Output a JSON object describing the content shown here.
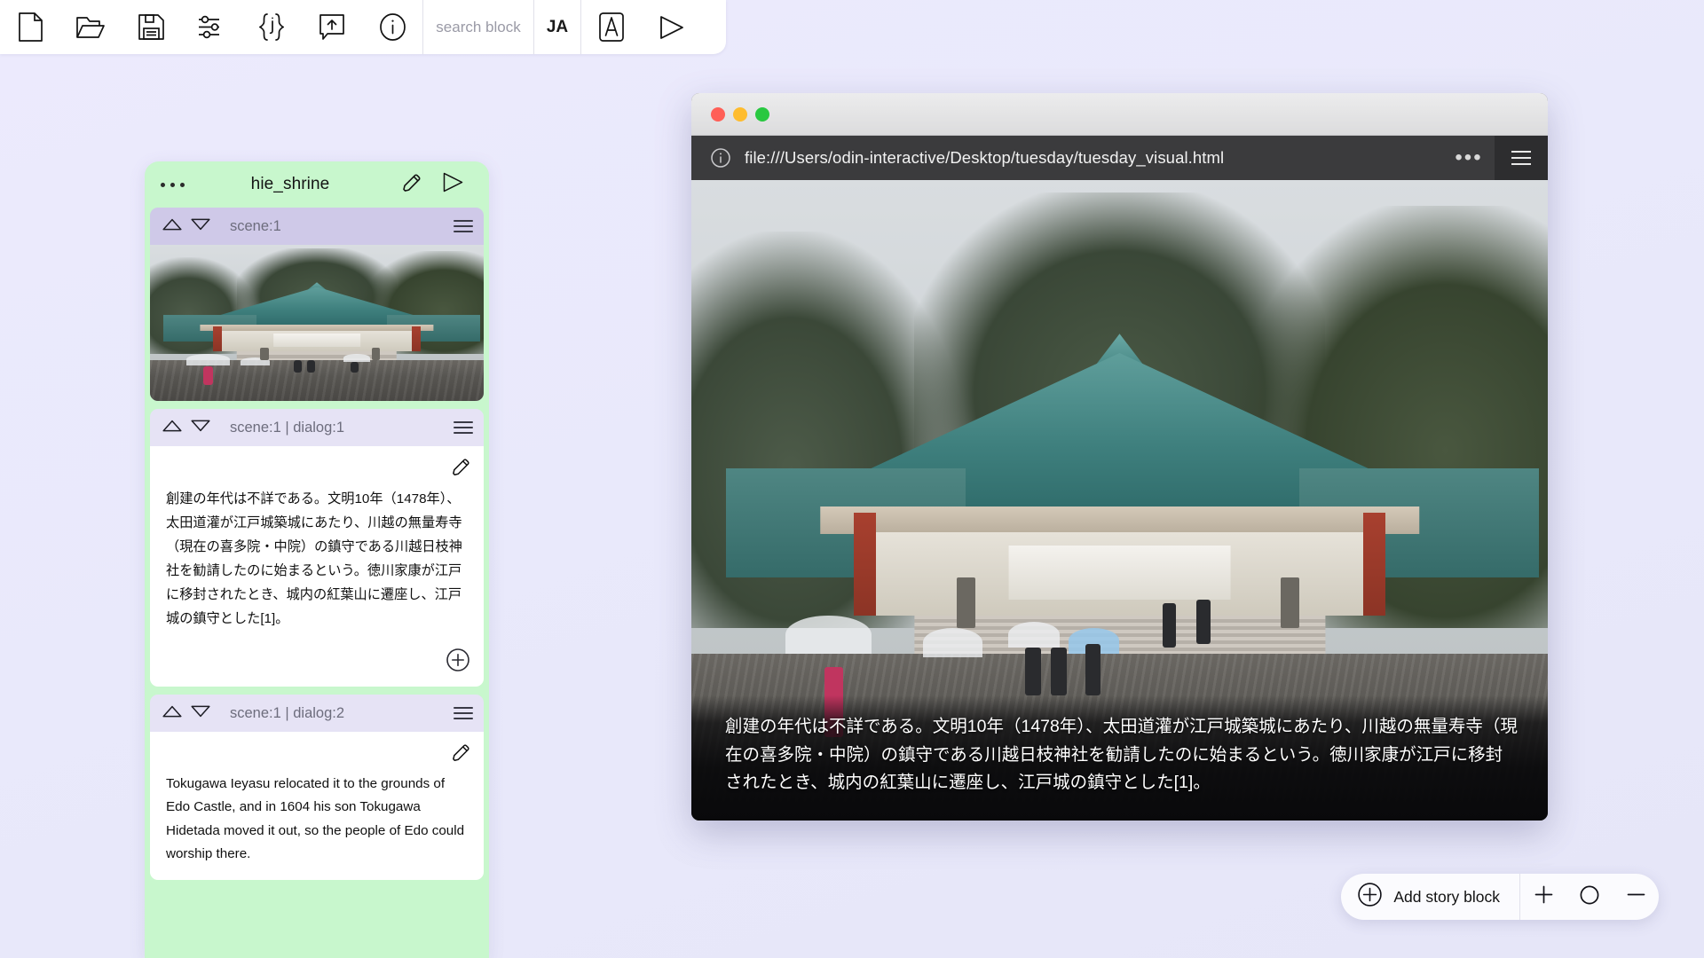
{
  "toolbar": {
    "buttons": [
      {
        "name": "new-file-icon",
        "label": "New"
      },
      {
        "name": "open-folder-icon",
        "label": "Open"
      },
      {
        "name": "save-disk-icon",
        "label": "Save"
      },
      {
        "name": "settings-sliders-icon",
        "label": "Settings"
      },
      {
        "name": "json-braces-icon",
        "label": "{j}"
      },
      {
        "name": "export-upload-icon",
        "label": "Export"
      },
      {
        "name": "info-icon",
        "label": "Info"
      }
    ],
    "search_placeholder": "search block",
    "language": "JA",
    "compass_icon": "compass-icon",
    "play_icon": "play-icon"
  },
  "story_panel": {
    "title": "hie_shrine",
    "menu_dots": "•••",
    "edit_icon": "pencil-icon",
    "play_icon": "play-icon",
    "blocks": [
      {
        "label": "scene:1",
        "type": "image"
      },
      {
        "label": "scene:1 | dialog:1",
        "type": "text",
        "text": "創建の年代は不詳である。文明10年（1478年）、太田道灌が江戸城築城にあたり、川越の無量寿寺（現在の喜多院・中院）の鎮守である川越日枝神社を勧請したのに始まるという。徳川家康が江戸に移封されたとき、城内の紅葉山に遷座し、江戸城の鎮守とした[1]。"
      },
      {
        "label": "scene:1 | dialog:2",
        "type": "text",
        "text": "Tokugawa Ieyasu relocated it to the grounds of Edo Castle, and in 1604 his son Tokugawa Hidetada moved it out, so the people of Edo could worship there."
      }
    ]
  },
  "browser": {
    "traffic_lights": [
      "#ff5f57",
      "#febc2e",
      "#28c840"
    ],
    "info_icon": "info-icon",
    "url": "file:///Users/odin-interactive/Desktop/tuesday/tuesday_visual.html",
    "overflow_dots": "•••",
    "menu_icon": "hamburger-menu-icon",
    "subtitle": "創建の年代は不詳である。文明10年（1478年）、太田道灌が江戸城築城にあたり、川越の無量寿寺（現在の喜多院・中院）の鎮守である川越日枝神社を勧請したのに始まるという。徳川家康が江戸に移封されたとき、城内の紅葉山に遷座し、江戸城の鎮守とした[1]。"
  },
  "bottom_bar": {
    "add_label": "Add story block",
    "add_icon": "plus-circle-icon",
    "zoom_in_icon": "plus-icon",
    "reset_icon": "circle-icon",
    "zoom_out_icon": "minus-icon"
  },
  "colors": {
    "panel_accent": "#c8f7cd",
    "block_header": "#cfc9e8",
    "block_header_light": "#e6e3f5",
    "canvas_bg": "#eaeafb"
  }
}
